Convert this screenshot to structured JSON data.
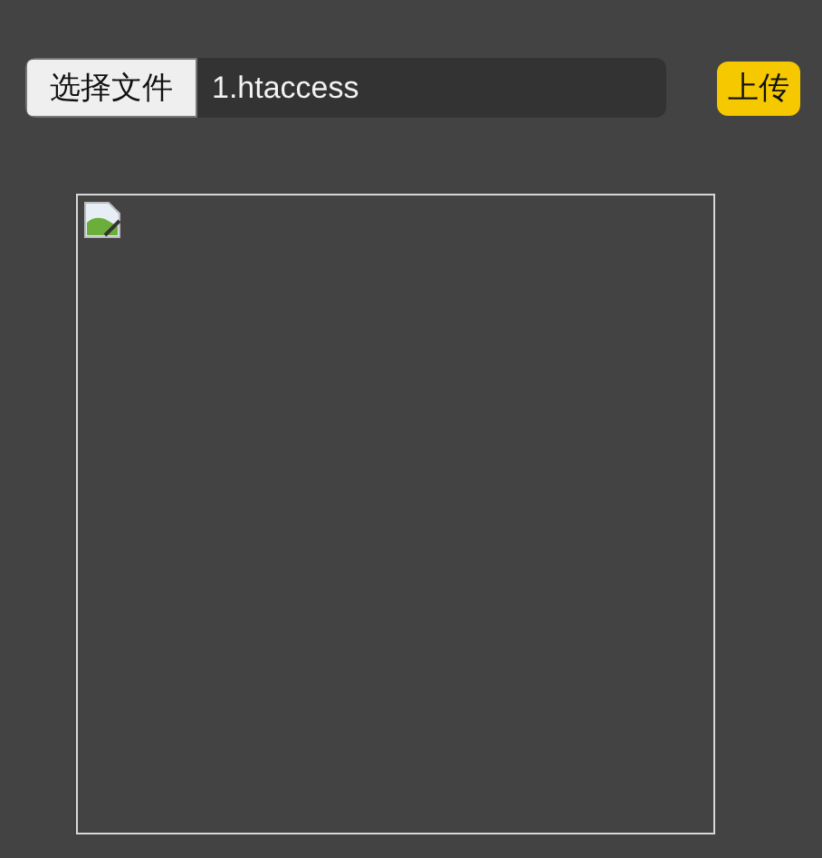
{
  "file_input": {
    "button": "选择文件",
    "value": "1.htaccess"
  },
  "upload_button": {
    "label": "上传"
  }
}
